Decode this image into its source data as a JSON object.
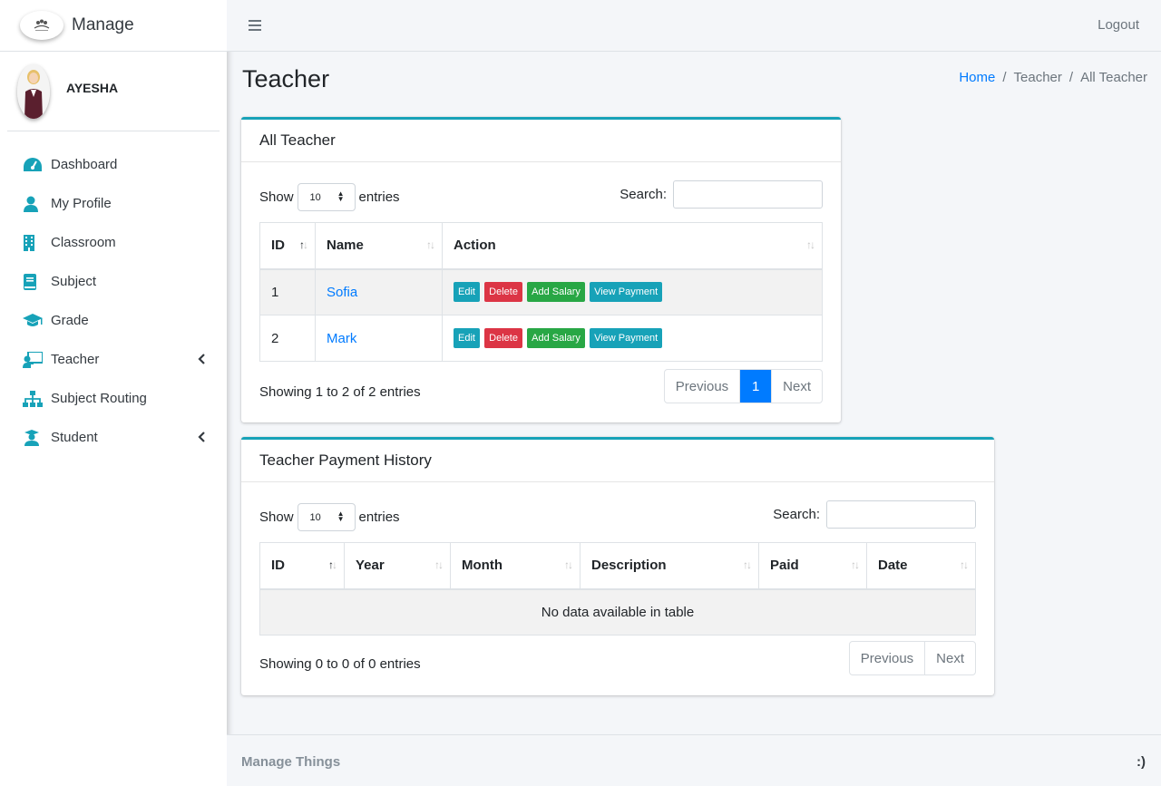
{
  "brand": {
    "title": "Manage"
  },
  "user": {
    "name": "AYESHA"
  },
  "sidebar": {
    "items": [
      {
        "label": "Dashboard",
        "icon": "dashboard-icon"
      },
      {
        "label": "My Profile",
        "icon": "user-icon"
      },
      {
        "label": "Classroom",
        "icon": "building-icon"
      },
      {
        "label": "Subject",
        "icon": "book-icon"
      },
      {
        "label": "Grade",
        "icon": "graduation-cap-icon"
      },
      {
        "label": "Teacher",
        "icon": "chalkboard-teacher-icon",
        "has_children": true
      },
      {
        "label": "Subject Routing",
        "icon": "sitemap-icon"
      },
      {
        "label": "Student",
        "icon": "student-icon",
        "has_children": true
      }
    ]
  },
  "topbar": {
    "logout_label": "Logout"
  },
  "page": {
    "title": "Teacher",
    "breadcrumb": [
      "Home",
      "/",
      "Teacher",
      "/",
      "All Teacher"
    ]
  },
  "teachers_card": {
    "title": "All Teacher",
    "show_label": "Show",
    "entries_label": "entries",
    "page_size": "10",
    "search_label": "Search:",
    "search_value": "",
    "columns": [
      "ID",
      "Name",
      "Action"
    ],
    "rows": [
      {
        "id": "1",
        "name": "Sofia"
      },
      {
        "id": "2",
        "name": "Mark"
      }
    ],
    "actions": {
      "edit": "Edit",
      "delete": "Delete",
      "add_salary": "Add Salary",
      "view_payment": "View Payment"
    },
    "info": "Showing 1 to 2 of 2 entries",
    "pagination": {
      "previous": "Previous",
      "current": "1",
      "next": "Next"
    }
  },
  "payments_card": {
    "title": "Teacher Payment History",
    "show_label": "Show",
    "entries_label": "entries",
    "page_size": "10",
    "search_label": "Search:",
    "search_value": "",
    "columns": [
      "ID",
      "Year",
      "Month",
      "Description",
      "Paid",
      "Date"
    ],
    "empty_text": "No data available in table",
    "info": "Showing 0 to 0 of 0 entries",
    "pagination": {
      "previous": "Previous",
      "next": "Next"
    }
  },
  "footer": {
    "left": "Manage Things",
    "right": ":)"
  },
  "colors": {
    "accent": "#17a2b8",
    "primary": "#007bff",
    "danger": "#dc3545",
    "success": "#28a745"
  }
}
